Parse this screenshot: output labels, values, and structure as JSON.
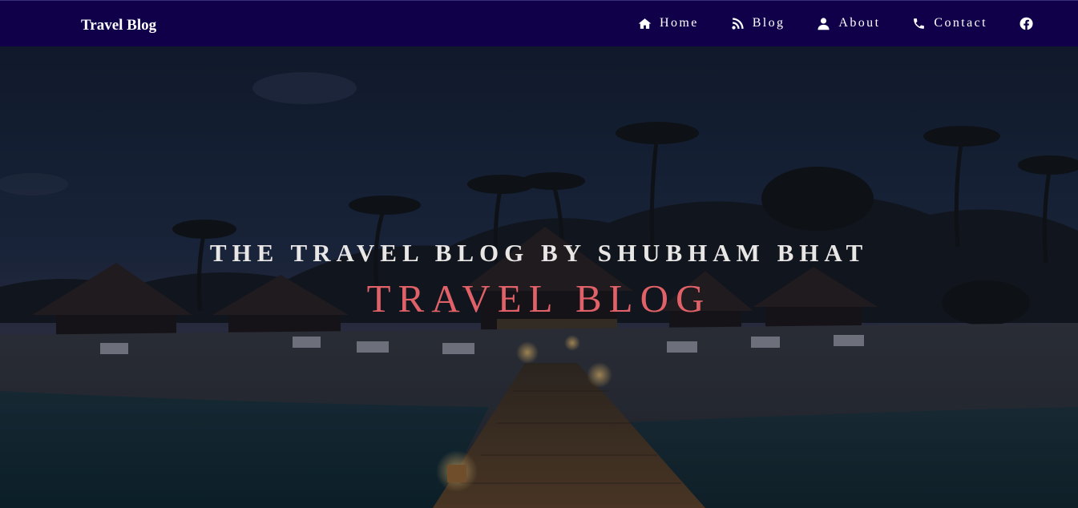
{
  "navbar": {
    "brand": "Travel Blog",
    "links": [
      {
        "label": "Home",
        "icon": "home-icon"
      },
      {
        "label": "Blog",
        "icon": "blog-feed-icon"
      },
      {
        "label": "About",
        "icon": "user-icon"
      },
      {
        "label": "Contact",
        "icon": "phone-icon"
      },
      {
        "label": "",
        "icon": "facebook-icon"
      }
    ]
  },
  "hero": {
    "subtitle": "THE TRAVEL BLOG BY SHUBHAM BHAT",
    "title": "TRAVEL BLOG",
    "background": "tropical beach resort at dusk with palm trees, thatched huts and a lit wooden pier"
  },
  "colors": {
    "navbar_bg": "#10004a",
    "title_accent": "#e06168",
    "subtitle": "#e9e6e6"
  }
}
